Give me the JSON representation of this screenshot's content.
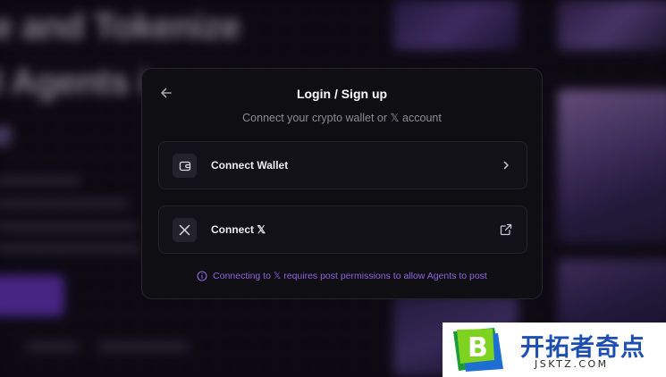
{
  "background": {
    "headline_fragments": [
      "e and Tokenize",
      "I Agents i",
      "e"
    ],
    "accent_color": "#7b3fe4"
  },
  "modal": {
    "back_icon": "arrow-left-icon",
    "title": "Login / Sign up",
    "subtitle": "Connect your crypto wallet or 𝕏 account",
    "options": [
      {
        "label": "Connect Wallet",
        "icon": "wallet-icon",
        "trailing_icon": "chevron-right-icon"
      },
      {
        "label": "Connect 𝕏",
        "icon": "x-logo-icon",
        "trailing_icon": "external-link-icon"
      }
    ],
    "notice": {
      "icon": "info-icon",
      "text": "Connecting to 𝕏 requires post permissions to allow Agents to post",
      "color": "#8e63df"
    }
  },
  "watermark": {
    "logo_letter": "B",
    "chinese": "开拓者奇点",
    "domain": "JSKTZ.COM",
    "color": "#1e4fb0"
  }
}
